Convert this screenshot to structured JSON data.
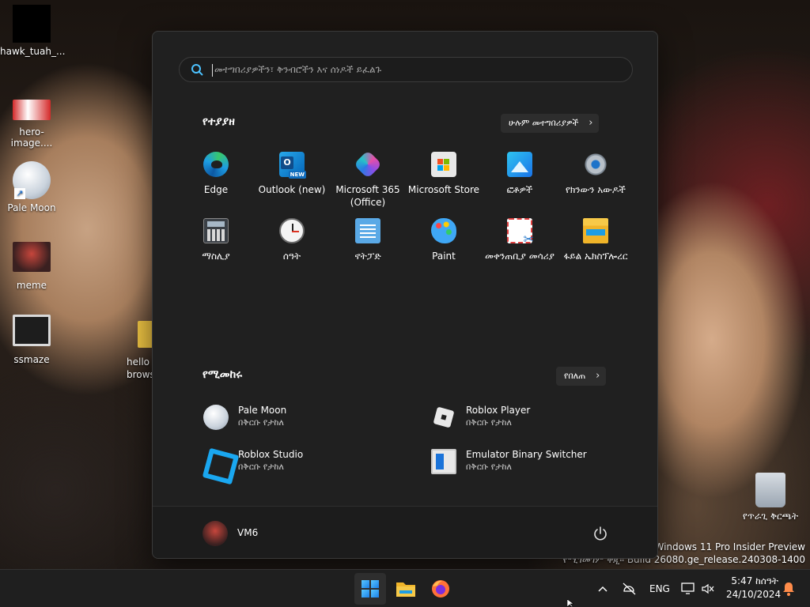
{
  "desktop": {
    "icons": [
      {
        "label": "hawk_tuah_..."
      },
      {
        "label": "hero-image...."
      },
      {
        "label": "Pale Moon"
      },
      {
        "label": "meme"
      },
      {
        "label": "ssmaze"
      },
      {
        "label": "የጥራጊ ቅርጫት"
      }
    ],
    "partial_label_line1": "hello l",
    "partial_label_line2": "brows",
    "watermark_line1": "Windows 11 Pro Insider Preview",
    "watermark_line2": "የሚገመገም ቅጂ። Build 26080.ge_release.240308-1400"
  },
  "start_menu": {
    "search_placeholder": "መተግበሪያዎችን፣ ቅንብሮችን እና ሰነዶች ይፈልጉ",
    "pinned_title": "የተያያዘ",
    "all_apps_label": "ሁሉም መተግበሪያዎች",
    "pinned": [
      {
        "label": "Edge",
        "icon": "edge-icon"
      },
      {
        "label": "Outlook (new)",
        "icon": "outlook-icon",
        "badge": "NEW"
      },
      {
        "label": "Microsoft 365 (Office)",
        "icon": "microsoft-365-icon"
      },
      {
        "label": "Microsoft Store",
        "icon": "store-icon"
      },
      {
        "label": "ፎቶዎች",
        "icon": "photos-icon"
      },
      {
        "label": "የክንውን አውዶች",
        "icon": "settings-icon"
      },
      {
        "label": "ማስሊያ",
        "icon": "calculator-icon"
      },
      {
        "label": "ሰዓት",
        "icon": "clock-icon"
      },
      {
        "label": "ኖትፓድ",
        "icon": "notepad-icon"
      },
      {
        "label": "Paint",
        "icon": "paint-icon"
      },
      {
        "label": "መቀንጠቢያ መሳሪያ",
        "icon": "snipping-tool-icon"
      },
      {
        "label": "ፋይል ኤክስፕሎረር",
        "icon": "file-explorer-icon"
      }
    ],
    "recommended_title": "የሚመከሩ",
    "more_label": "የበለጠ",
    "recommended": [
      {
        "title": "Pale Moon",
        "subtitle": "በቅርቡ የታከለ"
      },
      {
        "title": "Roblox Player",
        "subtitle": "በቅርቡ የታከለ"
      },
      {
        "title": "Roblox Studio",
        "subtitle": "በቅርቡ የታከለ"
      },
      {
        "title": "Emulator Binary Switcher",
        "subtitle": "በቅርቡ የታከለ"
      }
    ],
    "user_name": "VM6"
  },
  "taskbar": {
    "language": "ENG",
    "time": "5:47 ከሰዓት",
    "date": "24/10/2024"
  },
  "colors": {
    "accent": "#1a7fe8",
    "menu_bg": "#202020",
    "taskbar_bg": "#1f1f1f"
  }
}
